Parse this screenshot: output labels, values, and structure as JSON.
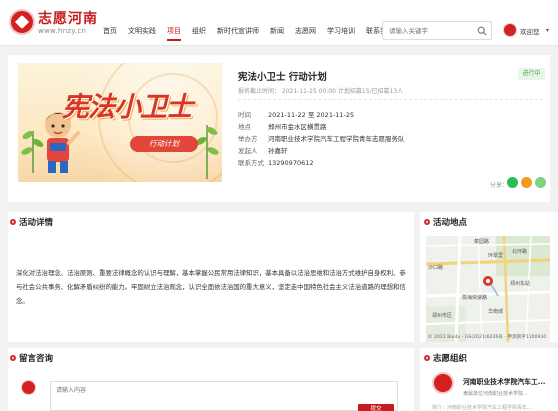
{
  "site": {
    "title": "志愿河南",
    "url": "www.hnzy.cn"
  },
  "nav": [
    {
      "label": "首页"
    },
    {
      "label": "文明实践"
    },
    {
      "label": "项目"
    },
    {
      "label": "组织"
    },
    {
      "label": "新时代宣讲师"
    },
    {
      "label": "新闻"
    },
    {
      "label": "志愿网"
    },
    {
      "label": "学习培训"
    },
    {
      "label": "联系我们"
    }
  ],
  "active_nav": "项目",
  "search": {
    "placeholder": "请输入关键字"
  },
  "user": {
    "welcome": "欢迎您"
  },
  "project": {
    "poster_title": "宪法小卫士",
    "poster_subtitle": "行动计划",
    "title": "宪法小卫士 行动计划",
    "meta": "报名截止时间： 2021-11-25 00:00    计划招募15/已招募13人",
    "status": "进行中",
    "info": [
      {
        "label": "时间",
        "value": "2021-11-22 至 2021-11-25"
      },
      {
        "label": "地点",
        "value": "郑州市金水区横贯路"
      },
      {
        "label": "举办方",
        "value": "河南职业技术学院汽车工程学院青年志愿服务队"
      },
      {
        "label": "发起人",
        "value": "孙嘉轩"
      },
      {
        "label": "联系方式",
        "value": "13290970612"
      }
    ],
    "share_label": "分享："
  },
  "sections": {
    "details": "活动详情",
    "location": "活动地点",
    "comments": "留言咨询",
    "organization": "志愿组织"
  },
  "details_paragraphs": [
    "深化对法治理念、法治原则、重要法律概念的认识与理解，基本掌握公民常用法律知识，基本具备以法治思维和法治方式维护自身权利、参与社会公共事务、化解矛盾纠纷的能力。牢固树立法治观念，认识全面依法治国的重大意义，坚定走中国特色社会主义法治道路的理想和信念。"
  ],
  "map": {
    "labels": [
      "菜园路",
      "环翠里",
      "沙口路",
      "陇海快速路",
      "郑州东站",
      "郑州市区",
      "华南城",
      "北环路"
    ],
    "credit": "© 2021 Baidu - GS(2021)6026号 - 甲测资字1100930"
  },
  "comment": {
    "placeholder": "请输入内容",
    "submit": "提交"
  },
  "organization": {
    "name": "河南职业技术学院汽车工...",
    "desc": "隶属单位河南职业技术学院...",
    "extra": "简介：河南职业技术学院汽车工程学院青年..."
  },
  "colors": {
    "brand_red": "#c81b1b",
    "status_green": "#4aa24a",
    "wechat_green": "#2dbb52",
    "weibo_orange": "#f39a1f"
  }
}
